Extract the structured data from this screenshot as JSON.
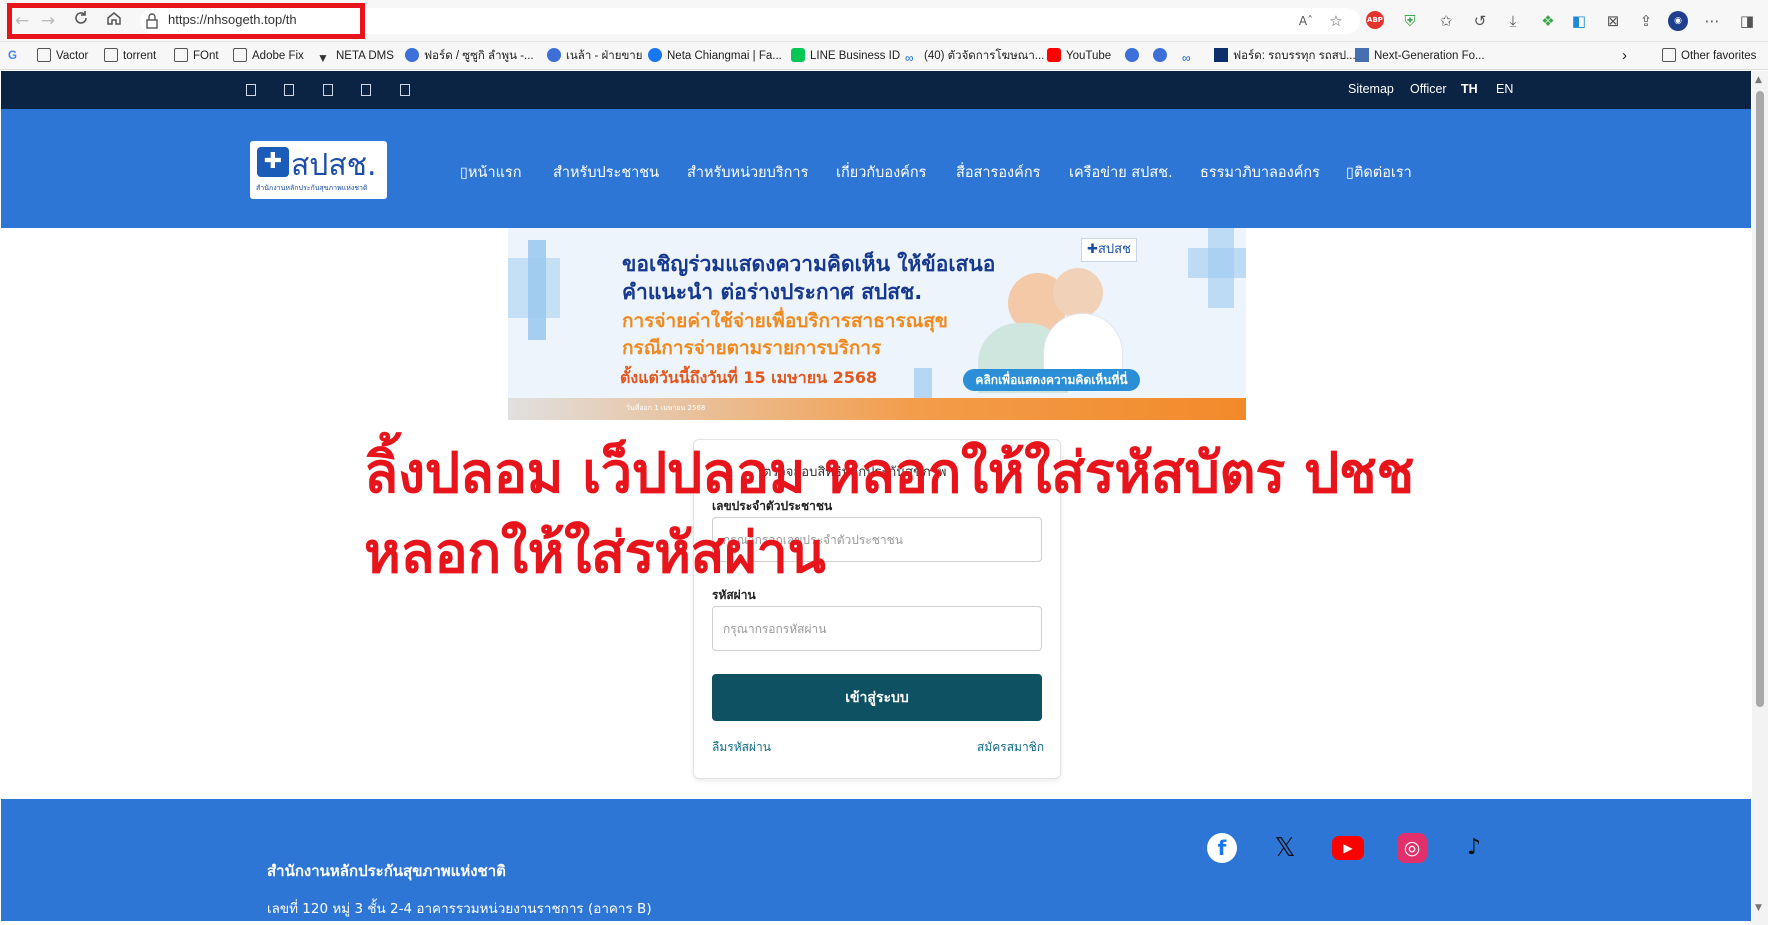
{
  "browser": {
    "url": "https://nhsogeth.top/th",
    "icons": [
      "back-icon",
      "forward-icon",
      "refresh-icon",
      "home-icon",
      "lock-icon",
      "read-aloud-icon",
      "favorite-star-icon",
      "adblock-icon",
      "shield-icon",
      "collections-icon",
      "history-icon",
      "download-icon",
      "extensions-icon",
      "edge-icon",
      "screenshot-icon",
      "share-icon",
      "profile-icon",
      "more-icon",
      "sidebar-icon"
    ],
    "read_aloud_label": "Aˆ",
    "adblock_label": "ABP"
  },
  "favorites": {
    "items": [
      "Vactor",
      "torrent",
      "FOnt",
      "Adobe Fix",
      "NETA DMS",
      "ฟอร์ด / ซูซูกิ ลำพูน -...",
      "เนล้า - ฝ่ายขาย",
      "Neta Chiangmai | Fa...",
      "LINE Business ID",
      "(40) ตัวจัดการโฆษณา...",
      "YouTube",
      "ฟอร์ด: รถบรรทุก รถสป...",
      "Next-Generation Fo..."
    ],
    "more": "›",
    "other": "Other favorites"
  },
  "site": {
    "topbar_links": [
      "Sitemap",
      "Officer",
      "TH",
      "EN"
    ],
    "topbar_glyphs": [
      "▯",
      "▯",
      "▯",
      "▯",
      "▯"
    ],
    "logo_mark": "✚",
    "logo_text": "สปสช.",
    "logo_sub": "สำนักงานหลักประกันสุขภาพแห่งชาติ",
    "menu": [
      "▯หน้าแรก",
      "สำหรับประชาชน",
      "สำหรับหน่วยบริการ",
      "เกี่ยวกับองค์กร",
      "สื่อสารองค์กร",
      "เครือข่าย สปสช.",
      "ธรรมาภิบาลองค์กร",
      "▯ติดต่อเรา"
    ],
    "banner": {
      "line1": "ขอเชิญร่วมแสดงความคิดเห็น ให้ข้อเสนอ",
      "line2": "คำแนะนำ ต่อร่างประกาศ สปสช.",
      "line3": "การจ่ายค่าใช้จ่ายเพื่อบริการสาธารณสุข",
      "line4": "กรณีการจ่ายตามรายการบริการ",
      "date": "ตั้งแต่วันนี้ถึงวันที่ 15 เมษายน 2568",
      "button": "คลิกเพื่อแสดงความคิดเห็นที่นี่",
      "logo": "✚สปสช",
      "footnote": "วันที่ออก 1 เมษายน 2568"
    },
    "login": {
      "title": "ตรวจสอบสิทธิหลักประกันสุขภาพ",
      "id_label": "เลขประจำตัวประชาชน",
      "id_placeholder": "กรุณากรอกเลขประจำตัวประชาชน",
      "pw_label": "รหัสผ่าน",
      "pw_placeholder": "กรุณากรอกรหัสผ่าน",
      "submit": "เข้าสู่ระบบ",
      "forgot": "ลืมรหัสผ่าน",
      "register": "สมัครสมาชิก"
    },
    "warning": {
      "line1": "ลิ้งปลอม เว็ปปลอม หลอกให้ใส่รหัสบัตร ปชช",
      "line2": "หลอกให้ใส่รหัสผ่าน"
    },
    "footer": {
      "org": "สำนักงานหลักประกันสุขภาพแห่งชาติ",
      "address": "เลขที่ 120 หมู่ 3 ชั้น 2-4 อาคารรวมหน่วยงานราชการ (อาคาร B)",
      "social": [
        "facebook-icon",
        "x-icon",
        "youtube-icon",
        "instagram-icon",
        "tiktok-icon"
      ],
      "social_glyphs": [
        "f",
        "𝕏",
        "▶",
        "◎",
        "♪"
      ]
    }
  },
  "colors": {
    "topbar": "#0b2443",
    "header": "#2e76d6",
    "login_button": "#0d5163",
    "warning_red": "#e8141b"
  }
}
